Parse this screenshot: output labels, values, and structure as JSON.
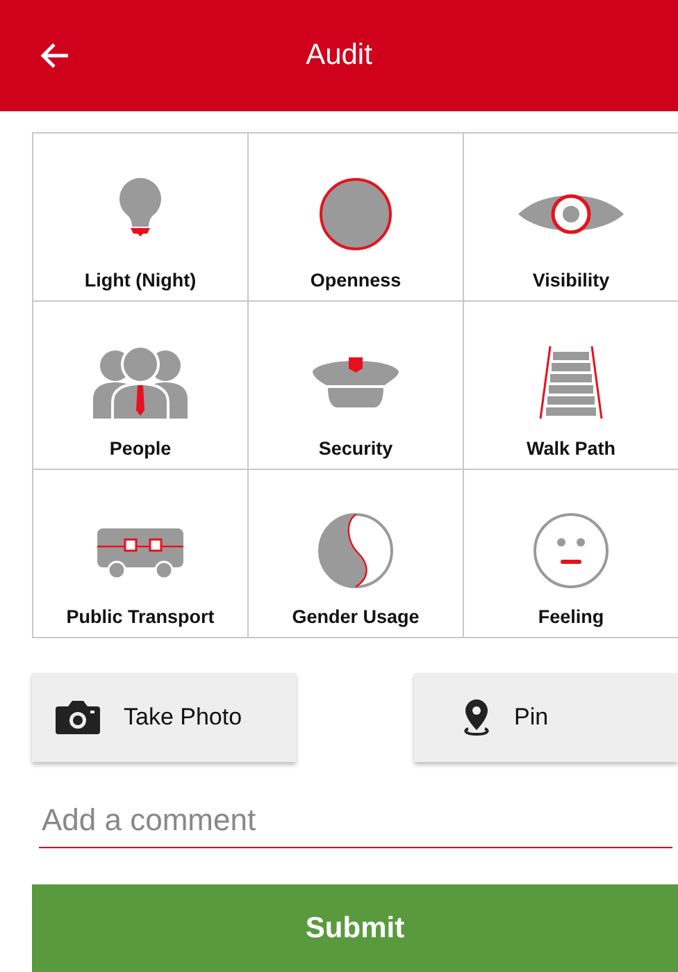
{
  "header": {
    "title": "Audit"
  },
  "categories": [
    {
      "kind": "bulb",
      "label": "Light (Night)"
    },
    {
      "kind": "circle",
      "label": "Openness"
    },
    {
      "kind": "eye",
      "label": "Visibility"
    },
    {
      "kind": "people",
      "label": "People"
    },
    {
      "kind": "cap",
      "label": "Security"
    },
    {
      "kind": "path",
      "label": "Walk Path"
    },
    {
      "kind": "bus",
      "label": "Public Transport"
    },
    {
      "kind": "yinyang",
      "label": "Gender Usage"
    },
    {
      "kind": "face",
      "label": "Feeling"
    }
  ],
  "actions": [
    {
      "kind": "camera",
      "label": "Take Photo"
    },
    {
      "kind": "pin",
      "label": "Pin"
    }
  ],
  "comment": {
    "placeholder": "Add a comment"
  },
  "submit": {
    "label": "Submit"
  }
}
